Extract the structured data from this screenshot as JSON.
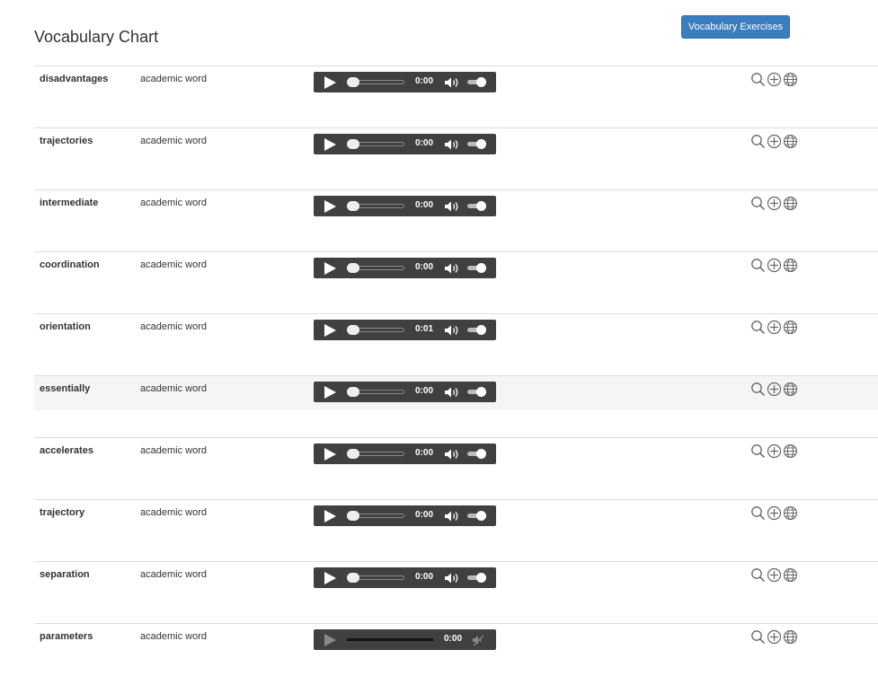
{
  "page": {
    "title": "Vocabulary Chart",
    "exercises_button": "Vocabulary Exercises"
  },
  "rows": [
    {
      "word": "disadvantages",
      "type": "academic word",
      "time": "0:00"
    },
    {
      "word": "trajectories",
      "type": "academic word",
      "time": "0:00"
    },
    {
      "word": "intermediate",
      "type": "academic word",
      "time": "0:00"
    },
    {
      "word": "coordination",
      "type": "academic word",
      "time": "0:00"
    },
    {
      "word": "orientation",
      "type": "academic word",
      "time": "0:01"
    },
    {
      "word": "essentially",
      "type": "academic word",
      "time": "0:00",
      "highlighted": true
    },
    {
      "word": "accelerates",
      "type": "academic word",
      "time": "0:00"
    },
    {
      "word": "trajectory",
      "type": "academic word",
      "time": "0:00"
    },
    {
      "word": "separation",
      "type": "academic word",
      "time": "0:00"
    },
    {
      "word": "parameters",
      "type": "academic word",
      "time": "0:00",
      "audio_disabled": true
    }
  ],
  "row_icons": [
    "search-icon",
    "add-circle-icon",
    "globe-icon"
  ],
  "colors": {
    "button": "#3a7ebf",
    "player": "#404040",
    "highlight": "#f5f5f5",
    "divider": "#dddddd"
  }
}
